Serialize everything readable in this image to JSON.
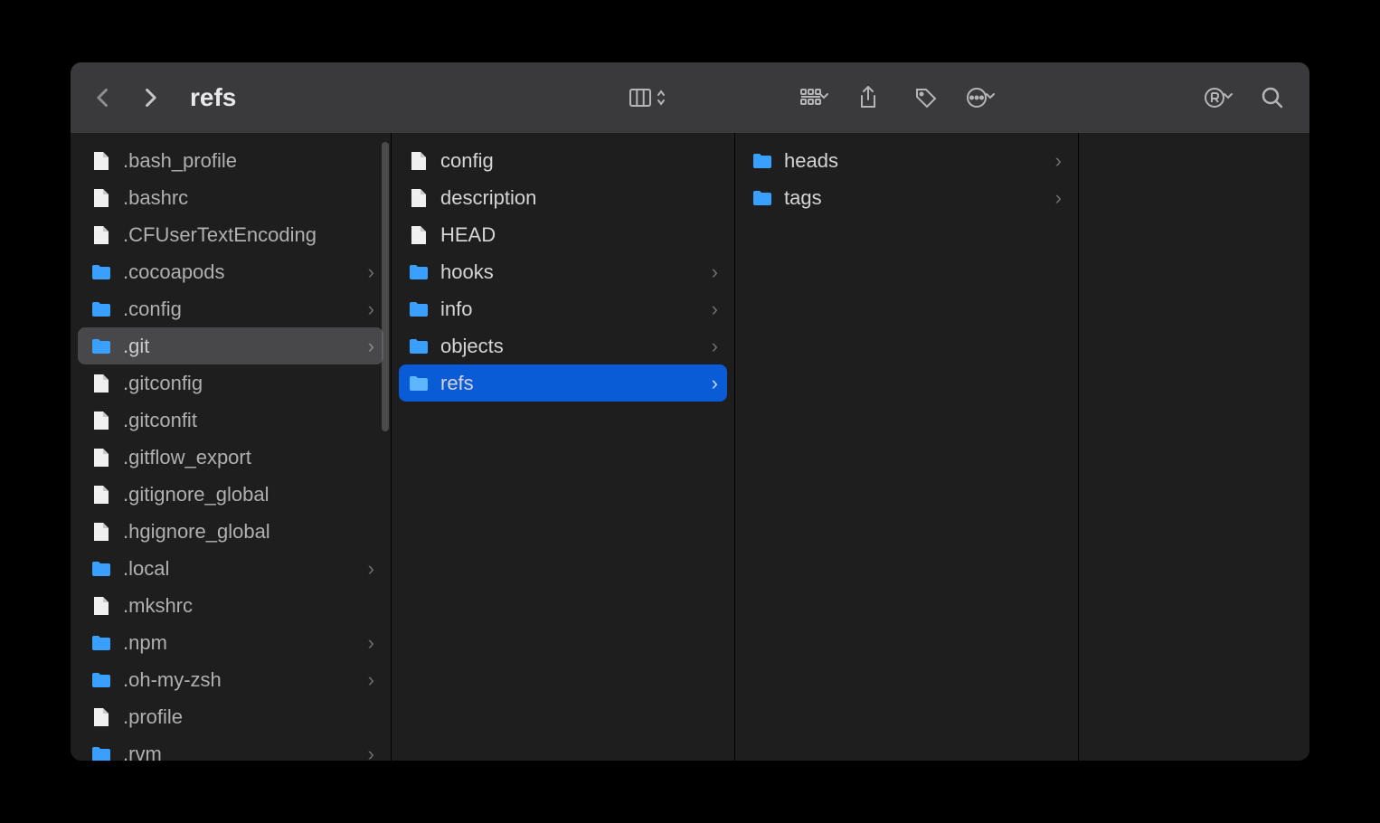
{
  "header": {
    "title": "refs"
  },
  "columns": [
    {
      "scroll_visible": true,
      "items": [
        {
          "name": ".bash_profile",
          "type": "file",
          "selected": "none",
          "has_children": false
        },
        {
          "name": ".bashrc",
          "type": "file",
          "selected": "none",
          "has_children": false
        },
        {
          "name": ".CFUserTextEncoding",
          "type": "file",
          "selected": "none",
          "has_children": false
        },
        {
          "name": ".cocoapods",
          "type": "folder",
          "selected": "none",
          "has_children": true
        },
        {
          "name": ".config",
          "type": "folder",
          "selected": "none",
          "has_children": true
        },
        {
          "name": ".git",
          "type": "folder",
          "selected": "dim",
          "has_children": true
        },
        {
          "name": ".gitconfig",
          "type": "file",
          "selected": "none",
          "has_children": false
        },
        {
          "name": ".gitconfit",
          "type": "file",
          "selected": "none",
          "has_children": false
        },
        {
          "name": ".gitflow_export",
          "type": "file",
          "selected": "none",
          "has_children": false
        },
        {
          "name": ".gitignore_global",
          "type": "file",
          "selected": "none",
          "has_children": false
        },
        {
          "name": ".hgignore_global",
          "type": "file",
          "selected": "none",
          "has_children": false
        },
        {
          "name": ".local",
          "type": "folder",
          "selected": "none",
          "has_children": true
        },
        {
          "name": ".mkshrc",
          "type": "file",
          "selected": "none",
          "has_children": false
        },
        {
          "name": ".npm",
          "type": "folder",
          "selected": "none",
          "has_children": true
        },
        {
          "name": ".oh-my-zsh",
          "type": "folder",
          "selected": "none",
          "has_children": true
        },
        {
          "name": ".profile",
          "type": "file",
          "selected": "none",
          "has_children": false
        },
        {
          "name": ".rvm",
          "type": "folder",
          "selected": "none",
          "has_children": true
        }
      ]
    },
    {
      "scroll_visible": false,
      "items": [
        {
          "name": "config",
          "type": "file",
          "selected": "none",
          "has_children": false
        },
        {
          "name": "description",
          "type": "file",
          "selected": "none",
          "has_children": false
        },
        {
          "name": "HEAD",
          "type": "file",
          "selected": "none",
          "has_children": false
        },
        {
          "name": "hooks",
          "type": "folder",
          "selected": "none",
          "has_children": true
        },
        {
          "name": "info",
          "type": "folder",
          "selected": "none",
          "has_children": true
        },
        {
          "name": "objects",
          "type": "folder",
          "selected": "none",
          "has_children": true
        },
        {
          "name": "refs",
          "type": "folder",
          "selected": "active",
          "has_children": true
        }
      ]
    },
    {
      "scroll_visible": false,
      "items": [
        {
          "name": "heads",
          "type": "folder",
          "selected": "none",
          "has_children": true
        },
        {
          "name": "tags",
          "type": "folder",
          "selected": "none",
          "has_children": true
        }
      ]
    },
    {
      "scroll_visible": false,
      "items": []
    }
  ]
}
